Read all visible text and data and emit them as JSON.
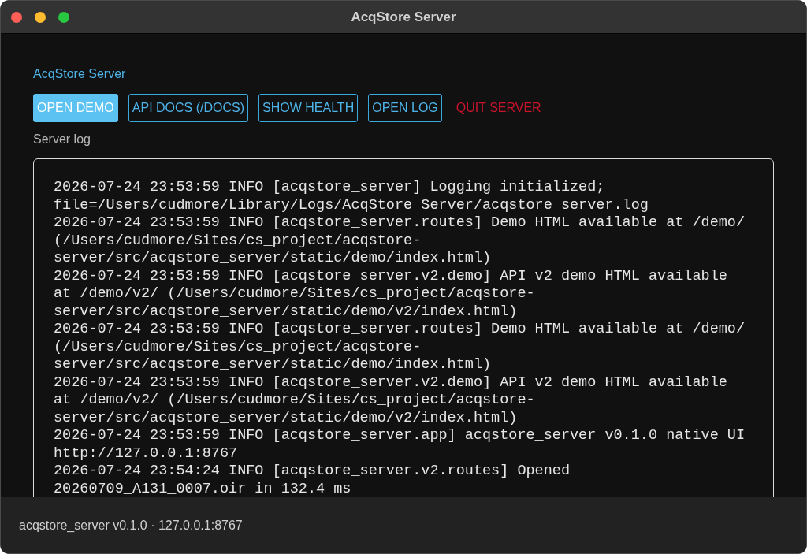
{
  "window": {
    "title": "AcqStore Server"
  },
  "heading": "AcqStore Server",
  "buttons": [
    {
      "label": "OPEN DEMO",
      "kind": "filled"
    },
    {
      "label": "API DOCS (/DOCS)",
      "kind": "outlined"
    },
    {
      "label": "SHOW HEALTH",
      "kind": "outlined"
    },
    {
      "label": "OPEN LOG",
      "kind": "outlined"
    },
    {
      "label": "QUIT SERVER",
      "kind": "danger"
    }
  ],
  "log": {
    "label": "Server log",
    "entries": [
      "2026-07-24 23:53:59 INFO [acqstore_server] Logging initialized; file=/Users/cudmore/Library/Logs/AcqStore Server/acqstore_server.log",
      "2026-07-24 23:53:59 INFO [acqstore_server.routes] Demo HTML available at /demo/ (/Users/cudmore/Sites/cs_project/acqstore-server/src/acqstore_server/static/demo/index.html)",
      "2026-07-24 23:53:59 INFO [acqstore_server.v2.demo] API v2 demo HTML available at /demo/v2/ (/Users/cudmore/Sites/cs_project/acqstore-server/src/acqstore_server/static/demo/v2/index.html)",
      "2026-07-24 23:53:59 INFO [acqstore_server.routes] Demo HTML available at /demo/ (/Users/cudmore/Sites/cs_project/acqstore-server/src/acqstore_server/static/demo/index.html)",
      "2026-07-24 23:53:59 INFO [acqstore_server.v2.demo] API v2 demo HTML available at /demo/v2/ (/Users/cudmore/Sites/cs_project/acqstore-server/src/acqstore_server/static/demo/v2/index.html)",
      "2026-07-24 23:53:59 INFO [acqstore_server.app] acqstore_server v0.1.0 native UI http://127.0.0.1:8767",
      "2026-07-24 23:54:24 INFO [acqstore_server.v2.routes] Opened 20260709_A131_0007.oir in 132.4 ms"
    ]
  },
  "status_bar": "acqstore_server v0.1.0 · 127.0.0.1:8767"
}
